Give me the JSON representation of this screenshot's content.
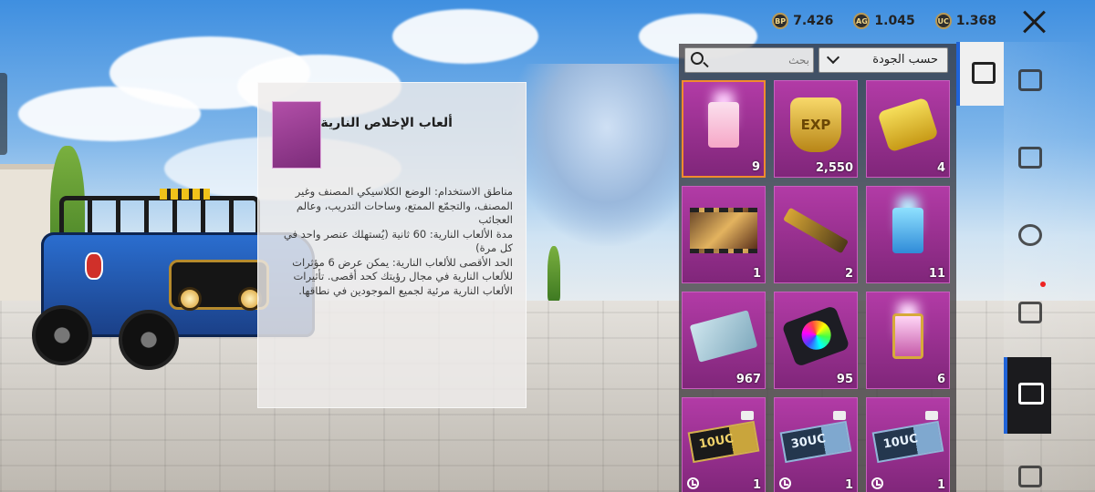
{
  "currencies": [
    {
      "icon": "bp-coin-icon",
      "icon_text": "BP",
      "value": "7.426"
    },
    {
      "icon": "ag-coin-icon",
      "icon_text": "AG",
      "value": "1.045"
    },
    {
      "icon": "uc-coin-icon",
      "icon_text": "UC",
      "value": "1.368"
    }
  ],
  "info": {
    "title": "ألعاب الإخلاص النارية",
    "desc_1": "مناطق الاستخدام: الوضع الكلاسيكي المصنف وغير المصنف، والتجمّع الممتع، وساحات التدريب، وعالم العجائب",
    "desc_2": "مدة الألعاب النارية: 60 ثانية (يُستهلك عنصر واحد في كل مرة)",
    "desc_3": "الحد الأقصى للألعاب النارية: يمكن عرض 6 مؤثرات للألعاب النارية في مجال رؤيتك كحد أقصى. تأثيرات الألعاب النارية مرئية لجميع الموجودين في نطاقها."
  },
  "search": {
    "placeholder": "بحث"
  },
  "sort": {
    "selected": "حسب الجودة"
  },
  "items": [
    {
      "name": "item-devotion-fireworks",
      "art": "firework",
      "count": "9",
      "selected": true
    },
    {
      "name": "item-exp-card",
      "art": "exp",
      "count": "2,550",
      "label": "EXP"
    },
    {
      "name": "item-puzzle-piece",
      "art": "puzzle",
      "count": "4"
    },
    {
      "name": "item-film-reel",
      "art": "film",
      "count": "1"
    },
    {
      "name": "item-gun-part",
      "art": "gun",
      "count": "2"
    },
    {
      "name": "item-blue-fireworks",
      "art": "firework-blue",
      "count": "11"
    },
    {
      "name": "item-name-card",
      "art": "card",
      "count": "967"
    },
    {
      "name": "item-color-palette",
      "art": "palette",
      "count": "95"
    },
    {
      "name": "item-gold-fireworks",
      "art": "firework-gold",
      "count": "6"
    },
    {
      "name": "item-10uc-voucher-gold",
      "art": "voucher",
      "label": "10UC",
      "count": "1",
      "timed": true
    },
    {
      "name": "item-30uc-voucher",
      "art": "voucher-blue",
      "label": "30UC",
      "count": "1",
      "timed": true
    },
    {
      "name": "item-10uc-voucher",
      "art": "voucher-blue",
      "label": "10UC",
      "count": "1",
      "timed": true
    }
  ]
}
